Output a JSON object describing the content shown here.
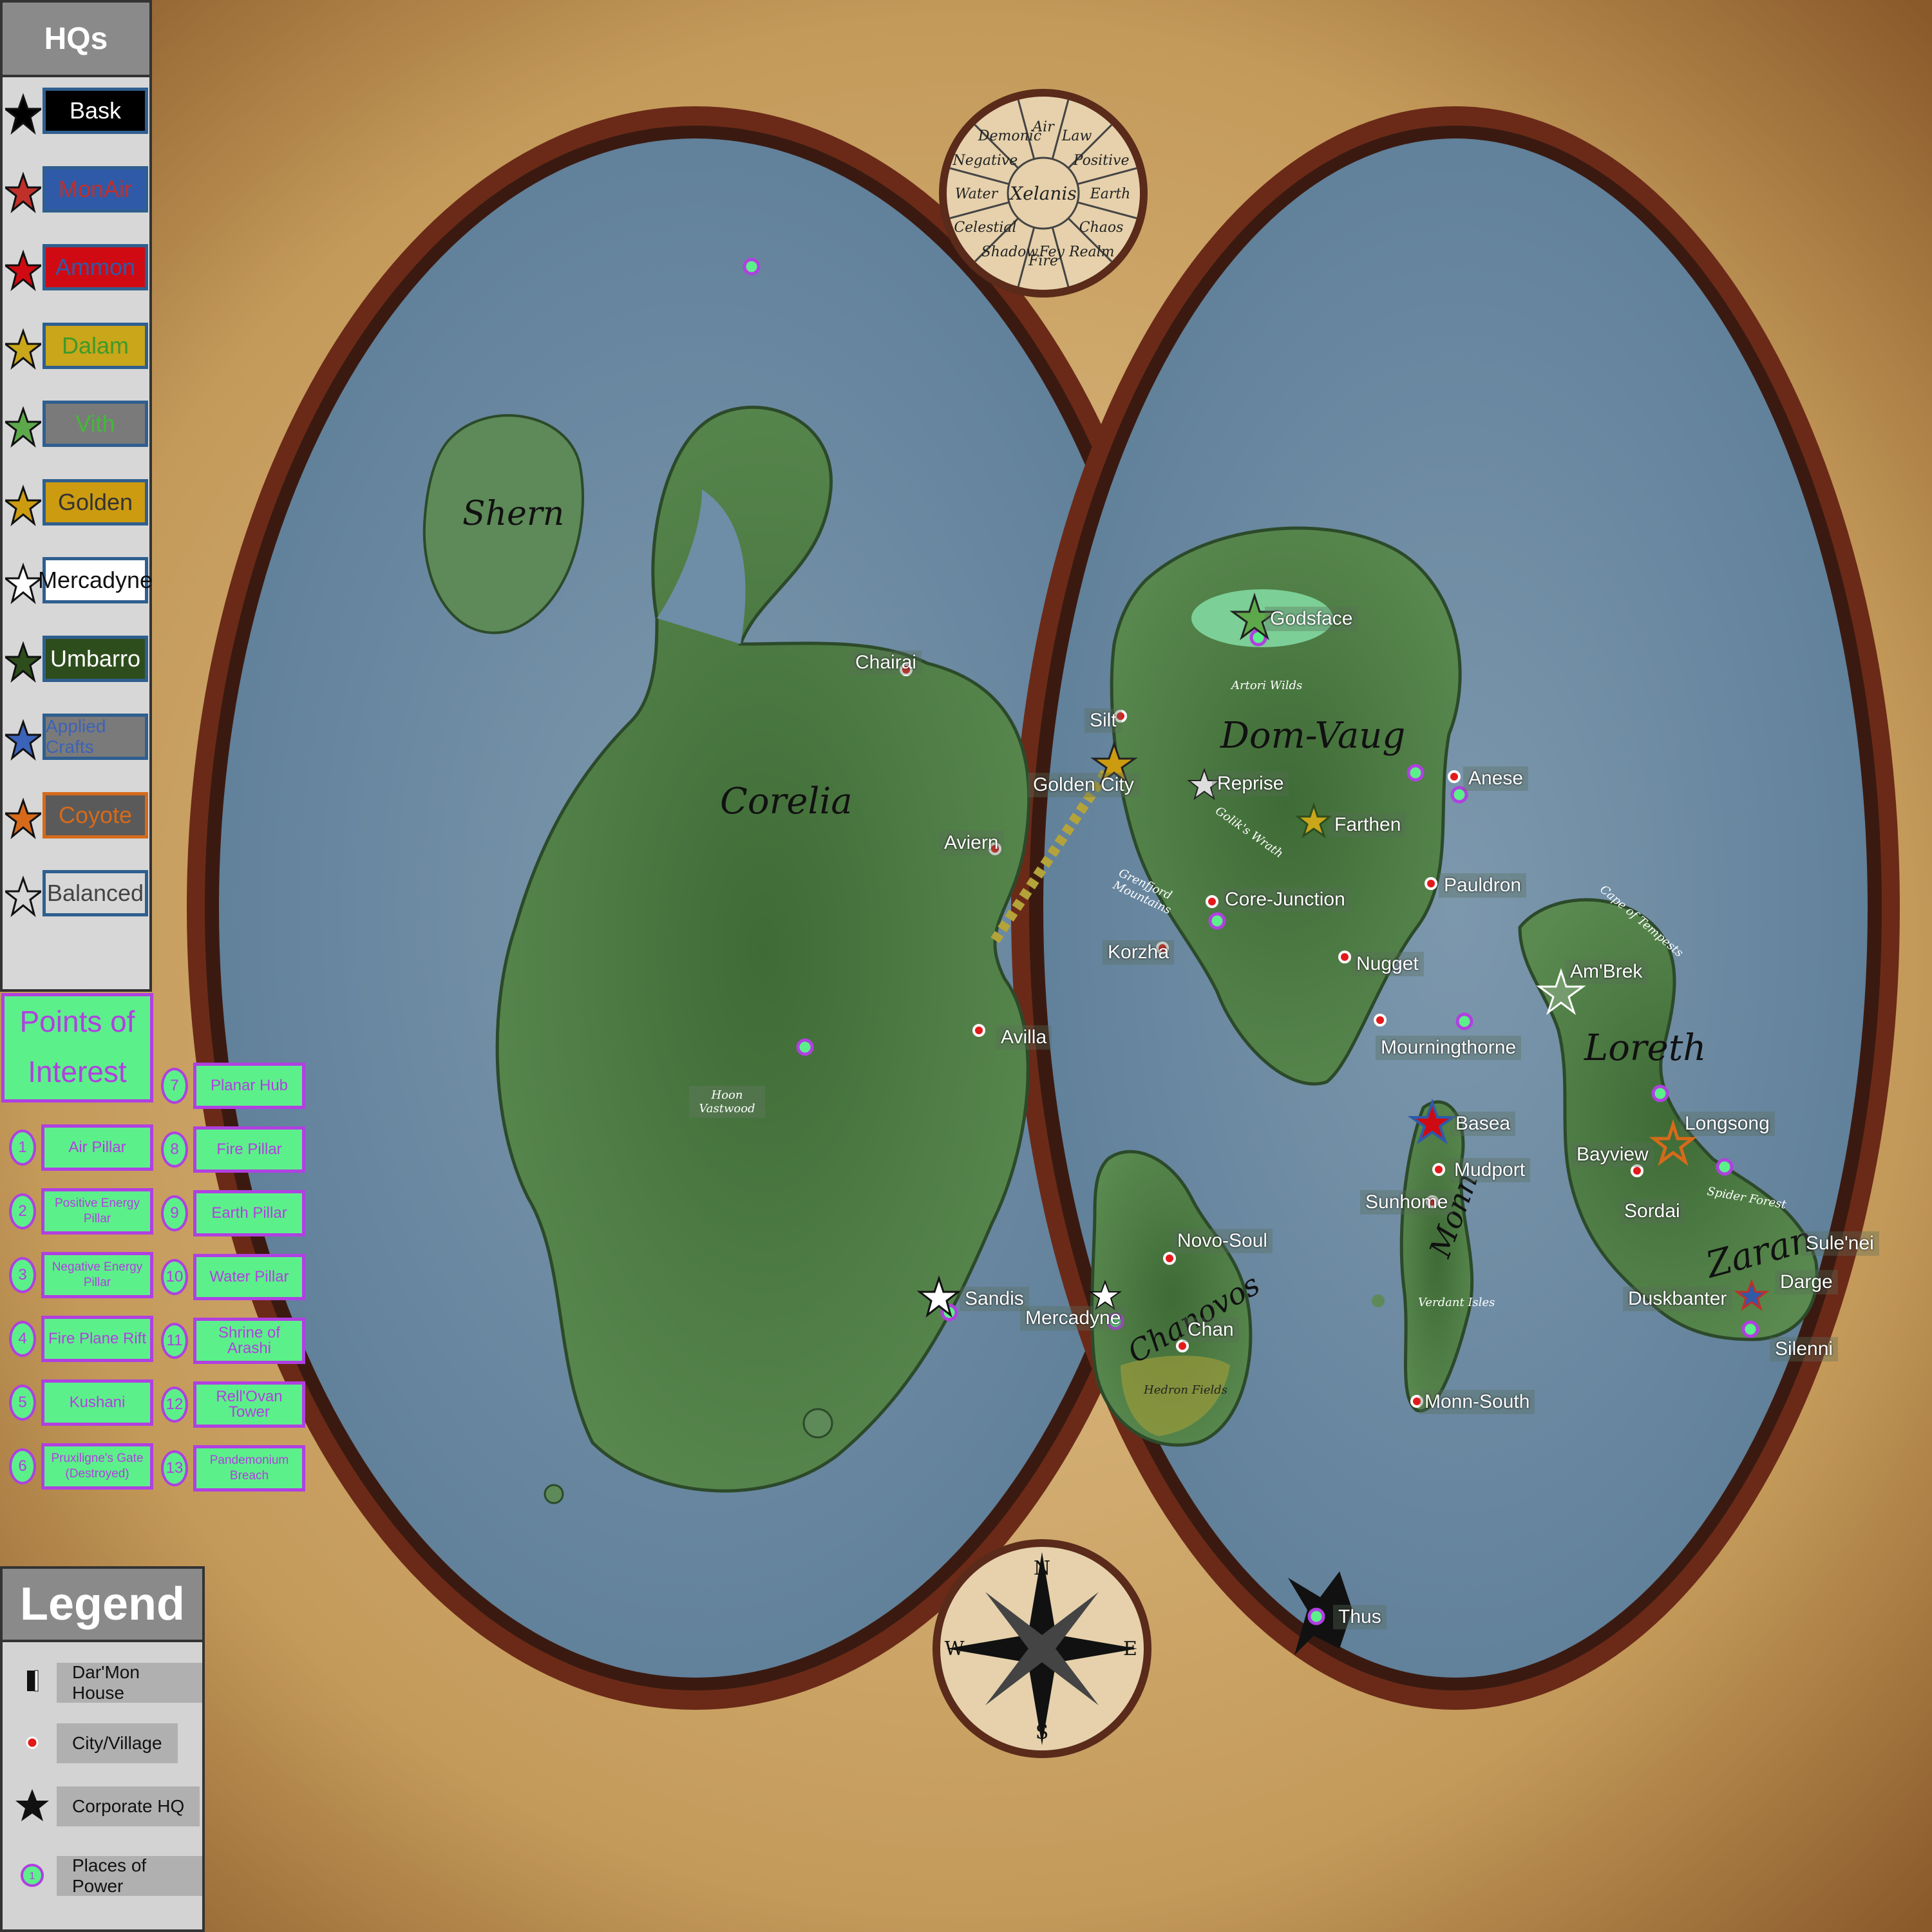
{
  "hq_panel": {
    "title": "HQs",
    "items": [
      {
        "label": "Bask",
        "box_bg": "#000000",
        "text": "#ffffff",
        "border": "#2f5f8f",
        "star": "#000000"
      },
      {
        "label": "MonAir",
        "box_bg": "#2f5aa8",
        "text": "#c0302a",
        "border": "#2f5f8f",
        "star": "#c0302a"
      },
      {
        "label": "Ammon",
        "box_bg": "#d00a12",
        "text": "#2f5aa8",
        "border": "#2f5f8f",
        "star": "#d00a12"
      },
      {
        "label": "Dalam",
        "box_bg": "#c9a61a",
        "text": "#3e9a2a",
        "border": "#2f5f8f",
        "star": "#c9a61a"
      },
      {
        "label": "Vith",
        "box_bg": "#7a7a7a",
        "text": "#44b83a",
        "border": "#2f5f8f",
        "star": "#5ea84c"
      },
      {
        "label": "Golden",
        "box_bg": "#cc9b10",
        "text": "#333333",
        "border": "#2f5f8f",
        "star": "#cc9b10"
      },
      {
        "label": "Mercadyne",
        "box_bg": "#ffffff",
        "text": "#111111",
        "border": "#2f5f8f",
        "star": "#ffffff"
      },
      {
        "label": "Umbarro",
        "box_bg": "#2e4d1c",
        "text": "#ffffff",
        "border": "#2f5f8f",
        "star": "#2e4d1c"
      },
      {
        "label": "Applied Crafts",
        "box_bg": "#7a7a7a",
        "text": "#3b63b8",
        "border": "#2f5f8f",
        "star": "#3b63b8"
      },
      {
        "label": "Coyote",
        "box_bg": "#5a5a5a",
        "text": "#d66a1a",
        "border": "#d66a1a",
        "star": "#d66a1a"
      },
      {
        "label": "Balanced",
        "box_bg": "#d7d7d7",
        "text": "#444444",
        "border": "#2f5f8f",
        "star": "#d7d7d7"
      }
    ]
  },
  "poi": {
    "title_line1": "Points of",
    "title_line2": "Interest",
    "items": [
      {
        "num": "1",
        "label": "Air Pillar"
      },
      {
        "num": "2",
        "label": "Positive Energy Pillar"
      },
      {
        "num": "3",
        "label": "Negative Energy Pillar"
      },
      {
        "num": "4",
        "label": "Fire Plane Rift"
      },
      {
        "num": "5",
        "label": "Kushani"
      },
      {
        "num": "6",
        "label": "Pruxiligne's Gate (Destroyed)"
      },
      {
        "num": "7",
        "label": "Planar Hub"
      },
      {
        "num": "8",
        "label": "Fire Pillar"
      },
      {
        "num": "9",
        "label": "Earth Pillar"
      },
      {
        "num": "10",
        "label": "Water Pillar"
      },
      {
        "num": "11",
        "label": "Shrine of Arashi"
      },
      {
        "num": "12",
        "label": "Rell'Ovan Tower"
      },
      {
        "num": "13",
        "label": "Pandemonium Breach"
      }
    ]
  },
  "legend": {
    "title": "Legend",
    "items": [
      {
        "icon": "house-marker-icon",
        "label": "Dar'Mon House"
      },
      {
        "icon": "city-dot-icon",
        "label": "City/Village"
      },
      {
        "icon": "star-icon",
        "label": "Corporate HQ"
      },
      {
        "icon": "power-circle-icon",
        "label": "Places of Power"
      }
    ]
  },
  "planes_wheel": {
    "center": "Xelanis",
    "segments": [
      "Air",
      "Law",
      "Positive",
      "Earth",
      "Chaos",
      "Fey Realm",
      "Fire",
      "Shadow",
      "Celestial",
      "Water",
      "Negative",
      "Demonic"
    ]
  },
  "compass": {
    "n": "N",
    "s": "S",
    "e": "E",
    "w": "W"
  },
  "regions": {
    "shern": "Shern",
    "corelia": "Corelia",
    "dom_vaug": "Dom-Vaug",
    "loreth": "Loreth",
    "zaran": "Zaran",
    "chanovos": "Chanovos",
    "monn": "Monn",
    "hoon_vastwood": "Hoon Vastwood",
    "artori_wilds": "Artori Wilds",
    "grenfjord_mountains": "Grenfjord Mountains",
    "goliks_wrath": "Golik's Wrath",
    "cape_of_tempests": "Cape of Tempests",
    "verdant_isles": "Verdant Isles",
    "spider_forest": "Spider Forest",
    "hedron_fields": "Hedron Fields"
  },
  "places": [
    {
      "id": "chairai",
      "label": "Chairai"
    },
    {
      "id": "silt",
      "label": "Silt"
    },
    {
      "id": "golden-city",
      "label": "Golden City"
    },
    {
      "id": "aviern",
      "label": "Aviern"
    },
    {
      "id": "avilla",
      "label": "Avilla"
    },
    {
      "id": "sandis",
      "label": "Sandis"
    },
    {
      "id": "godsface",
      "label": "Godsface"
    },
    {
      "id": "reprise",
      "label": "Reprise"
    },
    {
      "id": "farthen",
      "label": "Farthen"
    },
    {
      "id": "anese",
      "label": "Anese"
    },
    {
      "id": "pauldron",
      "label": "Pauldron"
    },
    {
      "id": "core-junction",
      "label": "Core-Junction"
    },
    {
      "id": "korzha",
      "label": "Korzha"
    },
    {
      "id": "nugget",
      "label": "Nugget"
    },
    {
      "id": "mourningthorne",
      "label": "Mourningthorne"
    },
    {
      "id": "ambrek",
      "label": "Am'Brek"
    },
    {
      "id": "basea",
      "label": "Basea"
    },
    {
      "id": "mudport",
      "label": "Mudport"
    },
    {
      "id": "sunhome",
      "label": "Sunhome"
    },
    {
      "id": "longsong",
      "label": "Longsong"
    },
    {
      "id": "bayview",
      "label": "Bayview"
    },
    {
      "id": "sordai",
      "label": "Sordai"
    },
    {
      "id": "sulenei",
      "label": "Sule'nei"
    },
    {
      "id": "darge",
      "label": "Darge"
    },
    {
      "id": "duskbanter",
      "label": "Duskbanter"
    },
    {
      "id": "silenni",
      "label": "Silenni"
    },
    {
      "id": "novo-soul",
      "label": "Novo-Soul"
    },
    {
      "id": "mercadyne",
      "label": "Mercadyne"
    },
    {
      "id": "chan",
      "label": "Chan"
    },
    {
      "id": "monn-south",
      "label": "Monn-South"
    },
    {
      "id": "thus",
      "label": "Thus"
    }
  ],
  "colors": {
    "ocean": "#6f8da4",
    "land": "#4e7a45",
    "parchment": "#c9a36a",
    "frame": "#5a2a1a",
    "poi_green": "#5cf08a",
    "poi_purple": "#b040e0"
  }
}
